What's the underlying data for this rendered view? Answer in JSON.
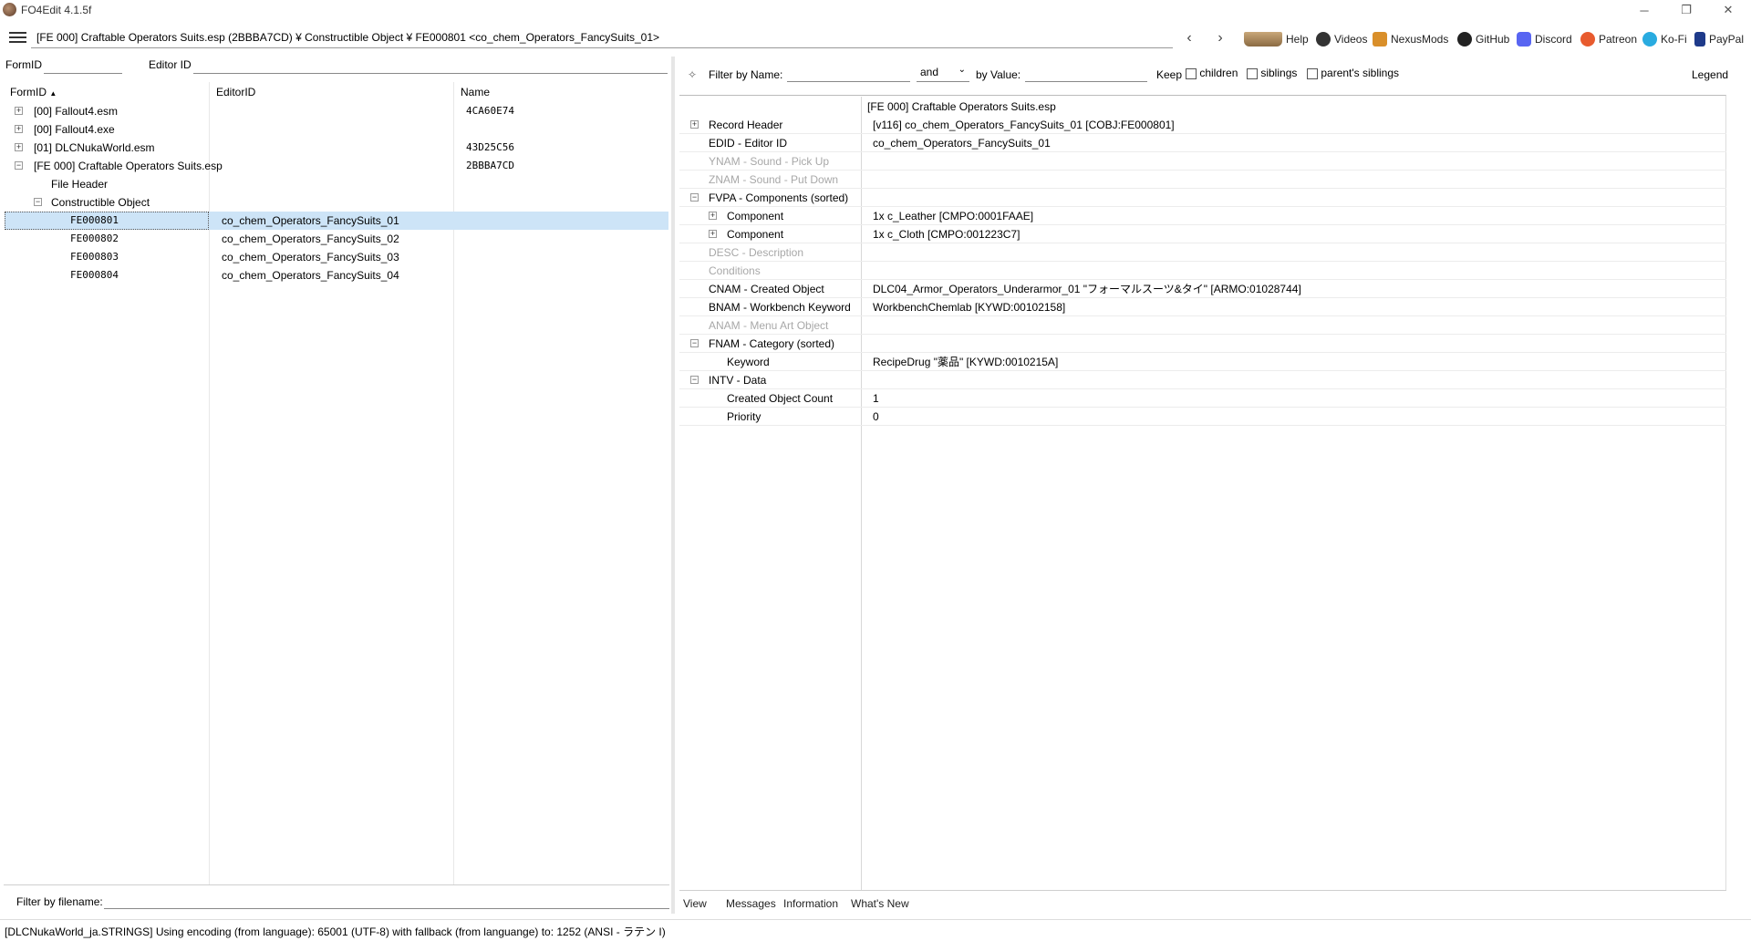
{
  "window": {
    "title": "FO4Edit 4.1.5f",
    "minimize": "─",
    "maximize": "❐",
    "close": "✕"
  },
  "toolbar": {
    "path": "[FE 000] Craftable Operators Suits.esp (2BBBA7CD) ¥ Constructible Object ¥ FE000801 <co_chem_Operators_FancySuits_01>",
    "back": "‹",
    "forward": "›",
    "links": [
      {
        "label": "Help",
        "icon": "book-icon"
      },
      {
        "label": "Videos",
        "icon": "video-icon"
      },
      {
        "label": "NexusMods",
        "icon": "nexusmods-icon"
      },
      {
        "label": "GitHub",
        "icon": "github-icon"
      },
      {
        "label": "Discord",
        "icon": "discord-icon"
      },
      {
        "label": "Patreon",
        "icon": "patreon-icon"
      },
      {
        "label": "Ko-Fi",
        "icon": "kofi-icon"
      },
      {
        "label": "PayPal",
        "icon": "paypal-icon"
      }
    ]
  },
  "left": {
    "formid_label": "FormID",
    "editorid_label": "Editor ID",
    "columns": {
      "formid": "FormID",
      "sort_arrow": "▲",
      "editorid": "EditorID",
      "name": "Name"
    },
    "tree": [
      {
        "formid": "[00] Fallout4.esm",
        "editorid": "",
        "name": "4CA60E74",
        "expander": "+"
      },
      {
        "formid": "[00] Fallout4.exe",
        "editorid": "",
        "name": "",
        "expander": "+"
      },
      {
        "formid": "[01] DLCNukaWorld.esm",
        "editorid": "",
        "name": "43D25C56",
        "expander": "+"
      },
      {
        "formid": "[FE 000] Craftable Operators Suits.esp",
        "editorid": "",
        "name": "2BBBA7CD",
        "expander": "−"
      },
      {
        "formid": "File Header",
        "editorid": "",
        "name": "",
        "expander": ""
      },
      {
        "formid": "Constructible Object",
        "editorid": "",
        "name": "",
        "expander": "−"
      },
      {
        "formid": "FE000801",
        "editorid": "co_chem_Operators_FancySuits_01",
        "name": "",
        "expander": ""
      },
      {
        "formid": "FE000802",
        "editorid": "co_chem_Operators_FancySuits_02",
        "name": "",
        "expander": ""
      },
      {
        "formid": "FE000803",
        "editorid": "co_chem_Operators_FancySuits_03",
        "name": "",
        "expander": ""
      },
      {
        "formid": "FE000804",
        "editorid": "co_chem_Operators_FancySuits_04",
        "name": "",
        "expander": ""
      }
    ],
    "filter_label": "Filter by filename:"
  },
  "right": {
    "pin": "✧",
    "filter_name_label": "Filter by Name:",
    "and_value": "and",
    "filter_value_label": "by Value:",
    "keep_label": "Keep",
    "children_label": "children",
    "siblings_label": "siblings",
    "parents_siblings_label": "parent's siblings",
    "legend_label": "Legend",
    "header_file": "[FE 000] Craftable Operators Suits.esp",
    "rows": [
      {
        "name": "Record Header",
        "value": "[v116] co_chem_Operators_FancySuits_01 [COBJ:FE000801]",
        "expander": "+",
        "indent": 0,
        "grey": false
      },
      {
        "name": "EDID - Editor ID",
        "value": "co_chem_Operators_FancySuits_01",
        "expander": "",
        "indent": 0,
        "grey": false
      },
      {
        "name": "YNAM - Sound - Pick Up",
        "value": "",
        "expander": "",
        "indent": 0,
        "grey": true
      },
      {
        "name": "ZNAM - Sound - Put Down",
        "value": "",
        "expander": "",
        "indent": 0,
        "grey": true
      },
      {
        "name": "FVPA - Components (sorted)",
        "value": "",
        "expander": "−",
        "indent": 0,
        "grey": false
      },
      {
        "name": "Component",
        "value": "1x c_Leather [CMPO:0001FAAE]",
        "expander": "+",
        "indent": 1,
        "grey": false
      },
      {
        "name": "Component",
        "value": "1x c_Cloth [CMPO:001223C7]",
        "expander": "+",
        "indent": 1,
        "grey": false
      },
      {
        "name": "DESC - Description",
        "value": "",
        "expander": "",
        "indent": 0,
        "grey": true
      },
      {
        "name": "Conditions",
        "value": "",
        "expander": "",
        "indent": 0,
        "grey": true
      },
      {
        "name": "CNAM - Created Object",
        "value": "DLC04_Armor_Operators_Underarmor_01 \"フォーマルスーツ&タイ\" [ARMO:01028744]",
        "expander": "",
        "indent": 0,
        "grey": false
      },
      {
        "name": "BNAM - Workbench Keyword",
        "value": "WorkbenchChemlab [KYWD:00102158]",
        "expander": "",
        "indent": 0,
        "grey": false
      },
      {
        "name": "ANAM - Menu Art Object",
        "value": "",
        "expander": "",
        "indent": 0,
        "grey": true
      },
      {
        "name": "FNAM - Category (sorted)",
        "value": "",
        "expander": "−",
        "indent": 0,
        "grey": false
      },
      {
        "name": "Keyword",
        "value": "RecipeDrug \"薬品\" [KYWD:0010215A]",
        "expander": "",
        "indent": 1,
        "grey": false
      },
      {
        "name": "INTV - Data",
        "value": "",
        "expander": "−",
        "indent": 0,
        "grey": false
      },
      {
        "name": "Created Object Count",
        "value": "1",
        "expander": "",
        "indent": 1,
        "grey": false
      },
      {
        "name": "Priority",
        "value": "0",
        "expander": "",
        "indent": 1,
        "grey": false
      }
    ],
    "tabs": [
      "View",
      "Messages",
      "Information",
      "What's New"
    ]
  },
  "status": "[DLCNukaWorld_ja.STRINGS] Using encoding (from language): 65001 (UTF-8) with fallback (from languange) to: 1252  (ANSI - ラテン I)"
}
